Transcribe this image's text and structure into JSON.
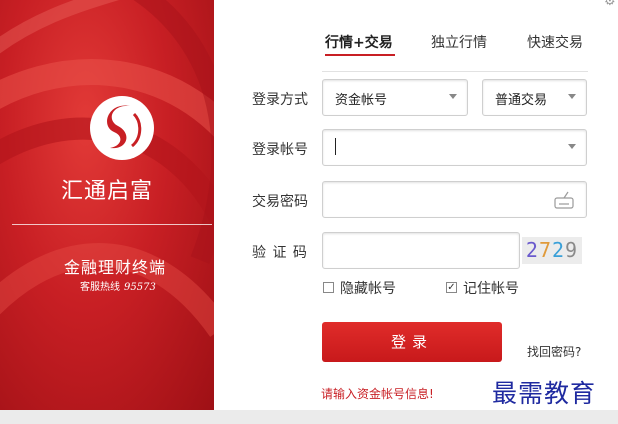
{
  "brand": {
    "name": "汇通启富",
    "subtitle": "金融理财终端",
    "hotline_label": "客服热线",
    "hotline_number": "95573",
    "color": "#c81f24"
  },
  "tabs": [
    {
      "label": "行情+交易",
      "active": true
    },
    {
      "label": "独立行情",
      "active": false
    },
    {
      "label": "快速交易",
      "active": false
    }
  ],
  "form": {
    "login_method": {
      "label": "登录方式",
      "value": "资金帐号",
      "mode": "普通交易"
    },
    "account": {
      "label": "登录帐号",
      "value": ""
    },
    "password": {
      "label": "交易密码",
      "value": ""
    },
    "captcha": {
      "label": "验 证 码",
      "value": "",
      "image_text": [
        "2",
        "7",
        "2",
        "9"
      ],
      "image_colors": [
        "#6a5acd",
        "#e09a3a",
        "#3aa0d8",
        "#8a8a8a"
      ]
    },
    "hide_account": {
      "label": "隐藏帐号",
      "checked": false
    },
    "remember_account": {
      "label": "记住帐号",
      "checked": true
    },
    "login_button": "登录",
    "forgot": "找回密码?",
    "error": "请输入资金帐号信息!"
  },
  "watermark": "最需教育",
  "icons": [
    "gear-icon",
    "keyboard-icon",
    "chevron-down-icon",
    "logo-icon"
  ]
}
